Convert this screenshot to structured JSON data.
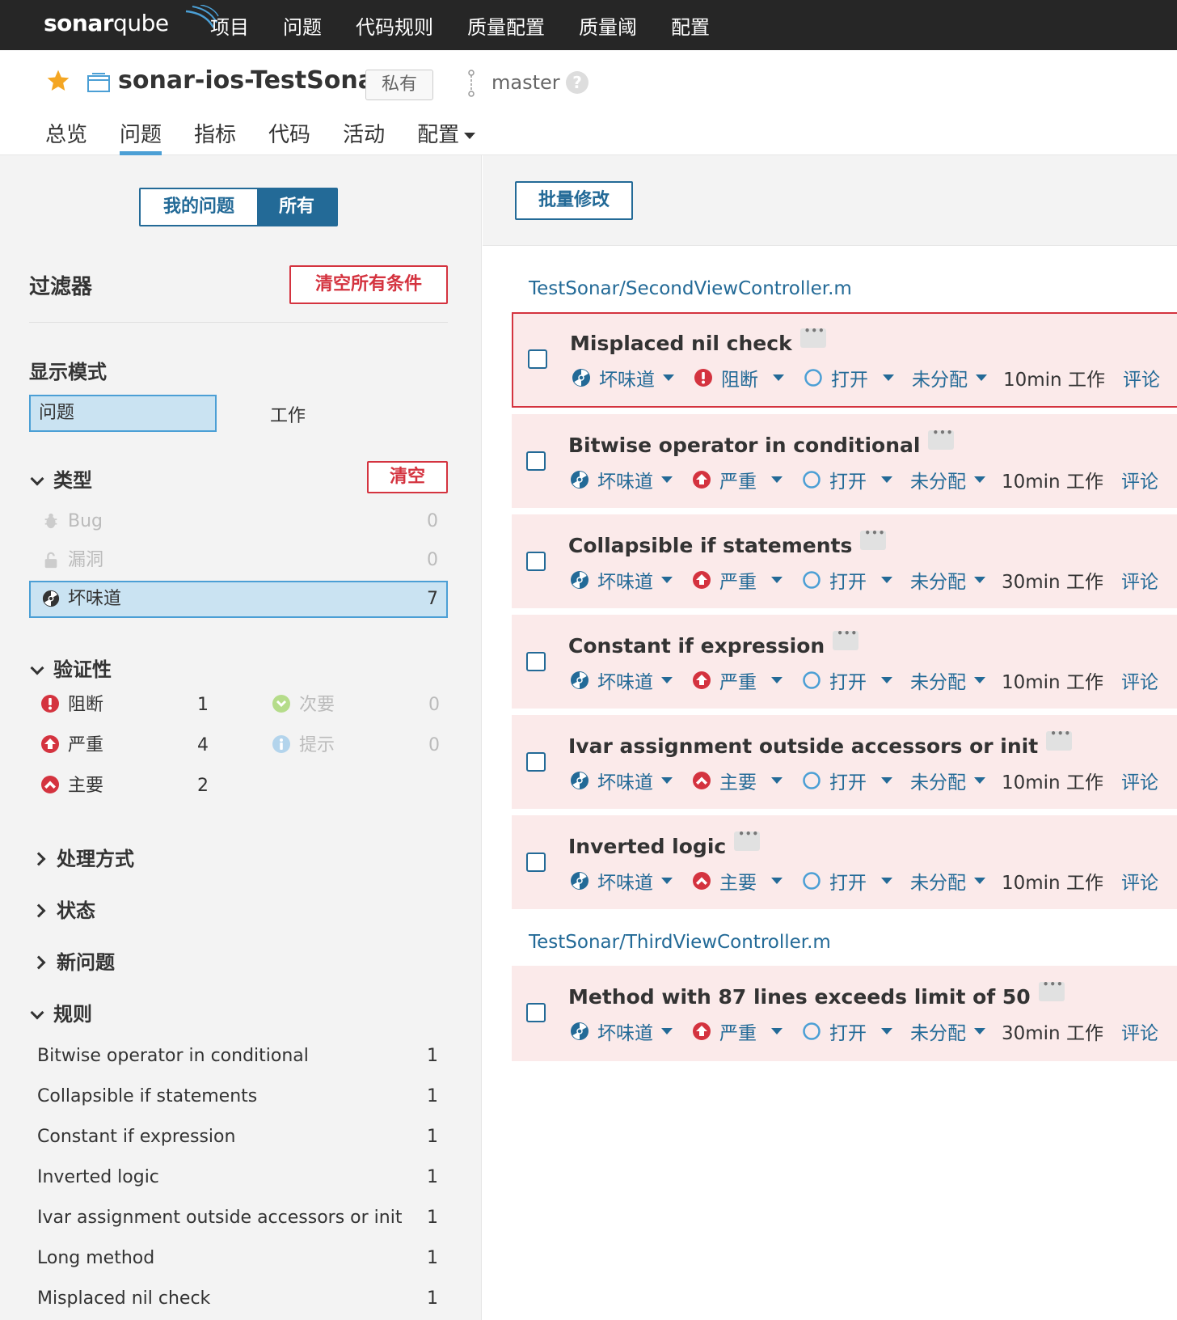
{
  "topbar": {
    "logo_bold": "sonar",
    "logo_thin": "qube",
    "nav": [
      "项目",
      "问题",
      "代码规则",
      "质量配置",
      "质量阈",
      "配置"
    ]
  },
  "project": {
    "name": "sonar-ios-TestSonar",
    "visibility": "私有",
    "branch": "master",
    "help": "?",
    "nav": [
      "总览",
      "问题",
      "指标",
      "代码",
      "活动",
      "配置"
    ],
    "active_nav": "问题"
  },
  "sidebar": {
    "seg_mine": "我的问题",
    "seg_all": "所有",
    "filter_title": "过滤器",
    "clear_all": "清空所有条件",
    "display_mode": {
      "title": "显示模式",
      "issues": "问题",
      "effort": "工作"
    },
    "type": {
      "title": "类型",
      "clear": "清空",
      "items": [
        {
          "label": "Bug",
          "count": "0",
          "icon": "bug-icon"
        },
        {
          "label": "漏洞",
          "count": "0",
          "icon": "lock-icon"
        },
        {
          "label": "坏味道",
          "count": "7",
          "icon": "code-smell-icon"
        }
      ]
    },
    "severity": {
      "title": "验证性",
      "blocker": {
        "label": "阻断",
        "count": "1"
      },
      "critical": {
        "label": "严重",
        "count": "4"
      },
      "major": {
        "label": "主要",
        "count": "2"
      },
      "minor": {
        "label": "次要",
        "count": "0"
      },
      "info": {
        "label": "提示",
        "count": "0"
      }
    },
    "collapsed": [
      "处理方式",
      "状态",
      "新问题"
    ],
    "rules": {
      "title": "规则",
      "items": [
        {
          "label": "Bitwise operator in conditional",
          "count": "1"
        },
        {
          "label": "Collapsible if statements",
          "count": "1"
        },
        {
          "label": "Constant if expression",
          "count": "1"
        },
        {
          "label": "Inverted logic",
          "count": "1"
        },
        {
          "label": "Ivar assignment outside accessors or init",
          "count": "1"
        },
        {
          "label": "Long method",
          "count": "1"
        },
        {
          "label": "Misplaced nil check",
          "count": "1"
        }
      ]
    }
  },
  "main": {
    "bulk_change": "批量修改",
    "file1": "TestSonar/SecondViewController.m",
    "file2": "TestSonar/ThirdViewController.m",
    "type_label": "坏味道",
    "status_label": "打开",
    "assignee_label": "未分配",
    "comment_label": "评论",
    "issues": [
      {
        "title": "Misplaced nil check",
        "severity": "阻断",
        "sev_key": "blocker",
        "effort": "10min 工作"
      },
      {
        "title": "Bitwise operator in conditional",
        "severity": "严重",
        "sev_key": "critical",
        "effort": "10min 工作"
      },
      {
        "title": "Collapsible if statements",
        "severity": "严重",
        "sev_key": "critical",
        "effort": "30min 工作"
      },
      {
        "title": "Constant if expression",
        "severity": "严重",
        "sev_key": "critical",
        "effort": "10min 工作"
      },
      {
        "title": "Ivar assignment outside accessors or init",
        "severity": "主要",
        "sev_key": "major",
        "effort": "10min 工作"
      },
      {
        "title": "Inverted logic",
        "severity": "主要",
        "sev_key": "major",
        "effort": "10min 工作"
      },
      {
        "title": "Method with 87 lines exceeds limit of 50",
        "severity": "严重",
        "sev_key": "critical",
        "effort": "30min 工作"
      }
    ]
  },
  "colors": {
    "accent": "#236a97",
    "link_blue": "#4b9fd5",
    "error_red": "#d4333f",
    "issue_bg": "#fbeaea",
    "topbar_bg": "#262626"
  }
}
